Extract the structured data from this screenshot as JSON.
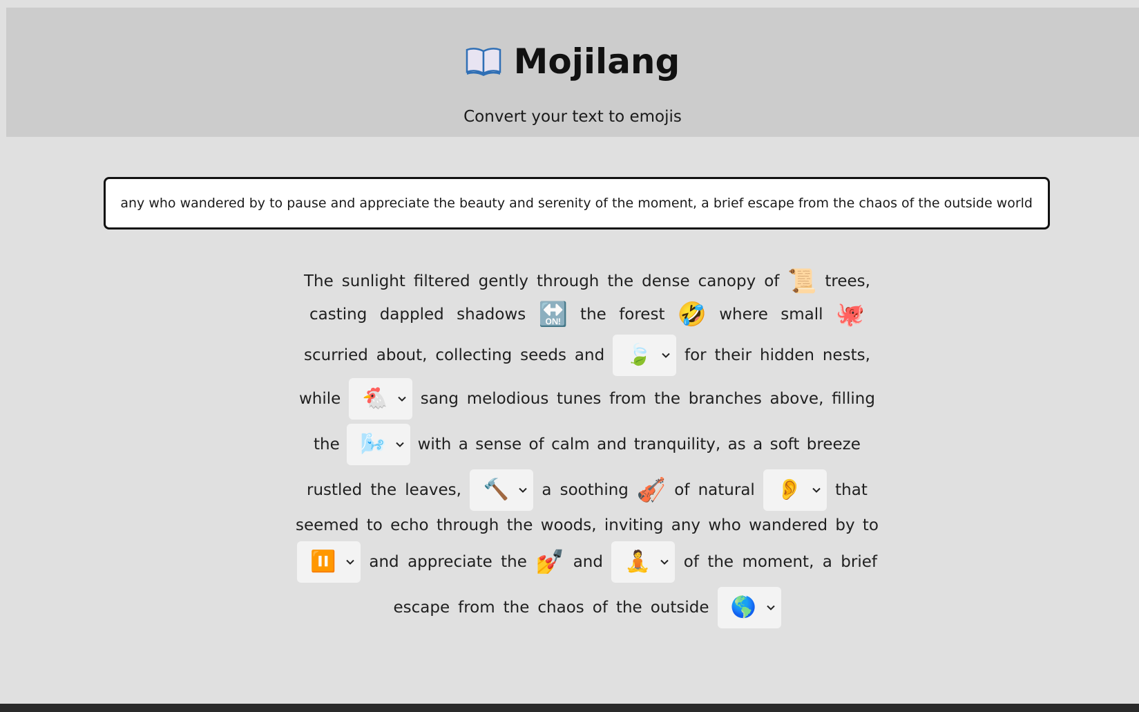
{
  "header": {
    "title": "Mojilang",
    "subtitle": "Convert your text to emojis",
    "logo_icon": "open-book-icon"
  },
  "input": {
    "value": "ing any who wandered by to pause and appreciate the beauty and serenity of the moment, a brief escape from the chaos of the outside world"
  },
  "output": {
    "l1": [
      "The",
      "sunlight",
      "filtered",
      "gently",
      "through",
      "the",
      "dense",
      "canopy",
      "of",
      "📜",
      "trees,"
    ],
    "l2": [
      "casting",
      "dappled",
      "shadows",
      "🔛",
      "the",
      "forest",
      "🤣",
      "where",
      "small",
      "🐙"
    ],
    "l3": [
      "scurried",
      "about,",
      "collecting",
      "seeds",
      "and",
      "🍃",
      "for",
      "their",
      "hidden",
      "nests,"
    ],
    "l4": [
      "while",
      "🐔",
      "sang",
      "melodious",
      "tunes",
      "from",
      "the",
      "branches",
      "above,",
      "filling"
    ],
    "l5": [
      "the",
      "🌬️",
      "with",
      "a",
      "sense",
      "of",
      "calm",
      "and",
      "tranquility,",
      "as",
      "a",
      "soft",
      "breeze"
    ],
    "l6": [
      "rustled",
      "the",
      "leaves,",
      "🔨",
      "a",
      "soothing",
      "🎻",
      "of",
      "natural",
      "👂",
      "that"
    ],
    "l7": [
      "seemed",
      "to",
      "echo",
      "through",
      "the",
      "woods,",
      "inviting",
      "any",
      "who",
      "wandered",
      "by",
      "to"
    ],
    "l8": [
      "⏸️",
      "and",
      "appreciate",
      "the",
      "💅",
      "and",
      "🧘",
      "of",
      "the",
      "moment,",
      "a",
      "brief"
    ],
    "l9": [
      "escape",
      "from",
      "the",
      "chaos",
      "of",
      "the",
      "outside",
      "🌎"
    ]
  },
  "colors": {
    "header_bg": "#cccccc",
    "page_bg": "#e0e0e0",
    "dropdown_bg": "#f3f3f3"
  }
}
